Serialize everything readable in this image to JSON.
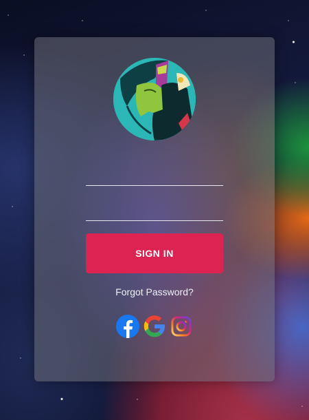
{
  "login": {
    "username_placeholder": "",
    "password_placeholder": "",
    "sign_in_label": "SIGN IN",
    "forgot_password_label": "Forgot Password?"
  },
  "social": [
    {
      "name": "facebook-icon",
      "color": "#1877f2"
    },
    {
      "name": "google-icon",
      "colors": [
        "#4285f4",
        "#34a853",
        "#fbbc05",
        "#ea4335"
      ]
    },
    {
      "name": "instagram-icon",
      "colors": [
        "#feda75",
        "#fa7e1e",
        "#d62976",
        "#962fbf",
        "#4f5bd5"
      ]
    }
  ],
  "colors": {
    "accent": "#dc2352",
    "avatar_background": "#2bb7b5"
  }
}
